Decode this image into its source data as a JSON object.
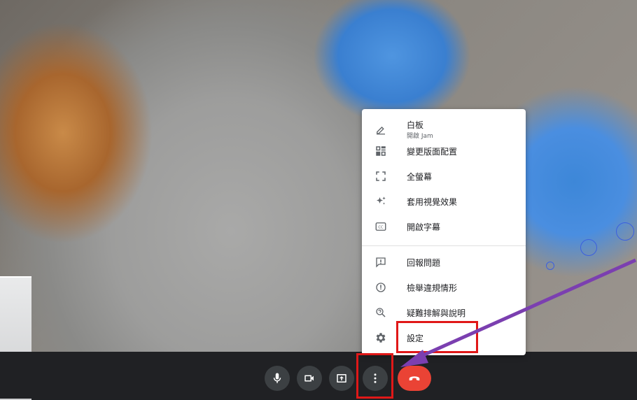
{
  "menu": {
    "items": [
      {
        "label": "白板",
        "sub": "開啟 Jam",
        "icon": "pencil-icon"
      },
      {
        "label": "變更版面配置",
        "icon": "layout-icon"
      },
      {
        "label": "全螢幕",
        "icon": "fullscreen-icon"
      },
      {
        "label": "套用視覺效果",
        "icon": "sparkle-icon"
      },
      {
        "label": "開啟字幕",
        "icon": "captions-icon"
      },
      {
        "label": "回報問題",
        "icon": "feedback-icon"
      },
      {
        "label": "檢舉違規情形",
        "icon": "report-icon"
      },
      {
        "label": "疑難排解與說明",
        "icon": "help-search-icon"
      },
      {
        "label": "設定",
        "icon": "gear-icon"
      }
    ]
  },
  "toolbar": {
    "buttons": [
      "mic-icon",
      "camera-icon",
      "present-icon",
      "more-options-icon",
      "hangup-icon"
    ],
    "hangup_color": "#ea4335"
  },
  "annotations": {
    "highlight_color": "#e01818",
    "arrow_color": "#7b3fb0"
  }
}
